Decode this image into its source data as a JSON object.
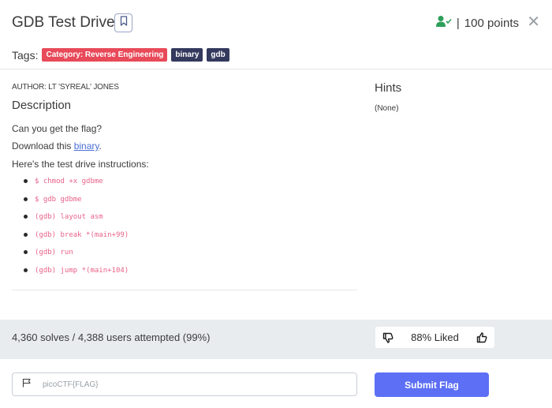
{
  "header": {
    "title": "GDB Test Drive",
    "points_separator": "|",
    "points": "100 points",
    "close_glyph": "✕"
  },
  "tags": {
    "label": "Tags:",
    "items": [
      "Category: Reverse Engineering",
      "binary",
      "gdb"
    ]
  },
  "description": {
    "author": "AUTHOR: LT 'SYREAL' JONES",
    "heading": "Description",
    "line1": "Can you get the flag?",
    "line2_prefix": "Download this ",
    "line2_link": "binary",
    "line2_suffix": ".",
    "line3": "Here's the test drive instructions:",
    "commands": [
      "$ chmod +x gdbme",
      "$ gdb gdbme",
      "(gdb) layout asm",
      "(gdb) break *(main+99)",
      "(gdb) run",
      "(gdb) jump *(main+104)"
    ]
  },
  "hints": {
    "heading": "Hints",
    "value": "(None)"
  },
  "stats": {
    "solves": "4,360 solves / 4,388 users attempted (99%)",
    "liked": "88% Liked"
  },
  "flag": {
    "placeholder": "picoCTF{FLAG}",
    "submit": "Submit Flag"
  },
  "colors": {
    "accent": "#5c6ff5",
    "category_tag": "#e84a5a",
    "tag_dark": "#34395e",
    "solved_icon": "#2e9e5b",
    "command_text": "#e8628a"
  },
  "icons": [
    "bookmark-icon",
    "user-check-icon",
    "close-icon",
    "thumbs-down-icon",
    "thumbs-up-icon",
    "flag-icon"
  ]
}
